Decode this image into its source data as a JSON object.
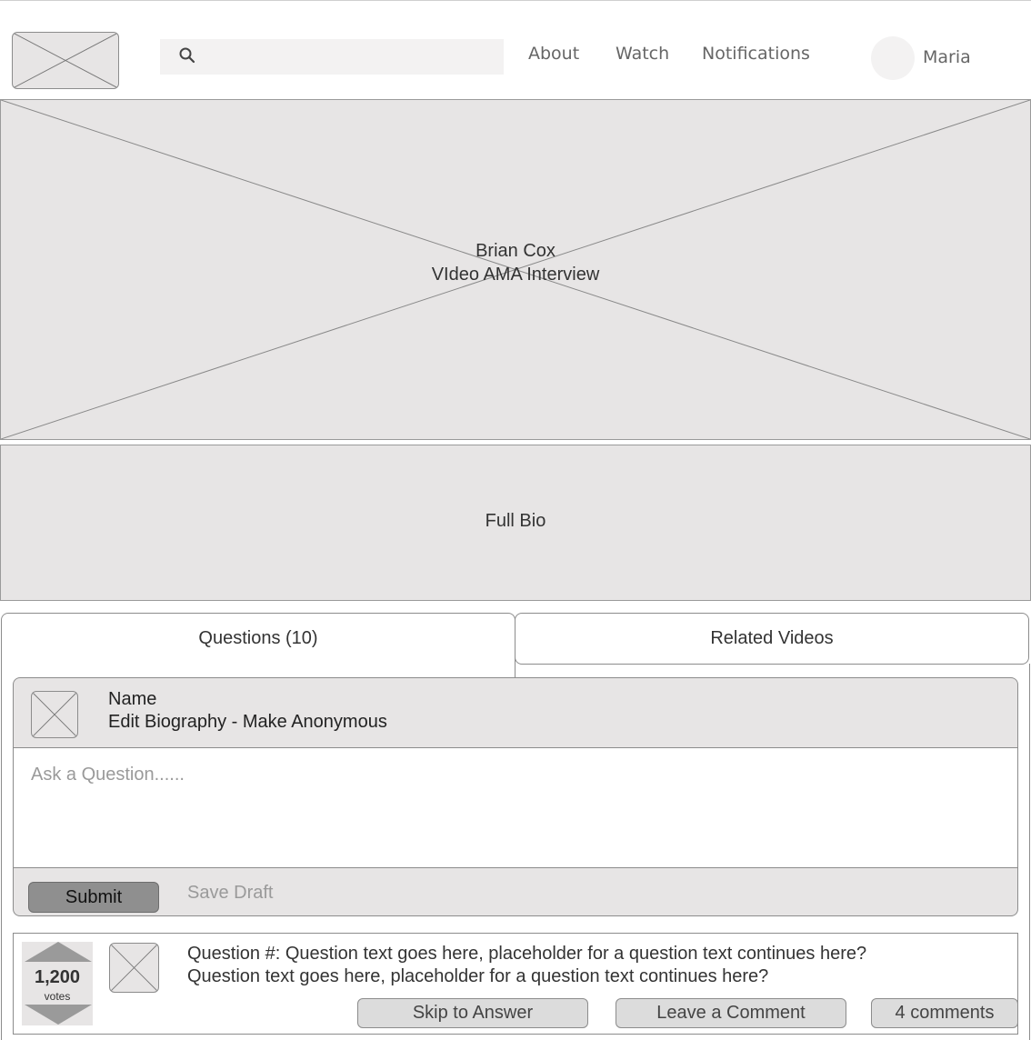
{
  "header": {
    "logo": "image-placeholder",
    "search": {
      "placeholder": "",
      "icon": "search-icon"
    },
    "nav": {
      "about": "About",
      "watch": "Watch",
      "notifications": "Notifications"
    },
    "user": {
      "name": "Maria"
    }
  },
  "video": {
    "title_line1": "Brian Cox",
    "title_line2": "VIdeo AMA Interview"
  },
  "bio": {
    "label": "Full Bio"
  },
  "tabs": [
    {
      "label": "Questions (10)",
      "active": true
    },
    {
      "label": "Related Videos",
      "active": false
    }
  ],
  "ask": {
    "name": "Name",
    "links": "Edit Biography - Make Anonymous",
    "placeholder": "Ask a Question......",
    "submit": "Submit",
    "save_draft": "Save Draft"
  },
  "question": {
    "votes": "1,200",
    "votes_label": "votes",
    "line1": "Question #: Question text goes here, placeholder for a question text continues here?",
    "line2": "Question text goes here, placeholder for a question text continues here?",
    "skip": "Skip to Answer",
    "comment": "Leave a Comment",
    "comments_count": "4 comments"
  },
  "colors": {
    "placeholder_fill": "#e7e5e5",
    "border": "#8c8c8c",
    "submit_fill": "#8f8f8f"
  }
}
